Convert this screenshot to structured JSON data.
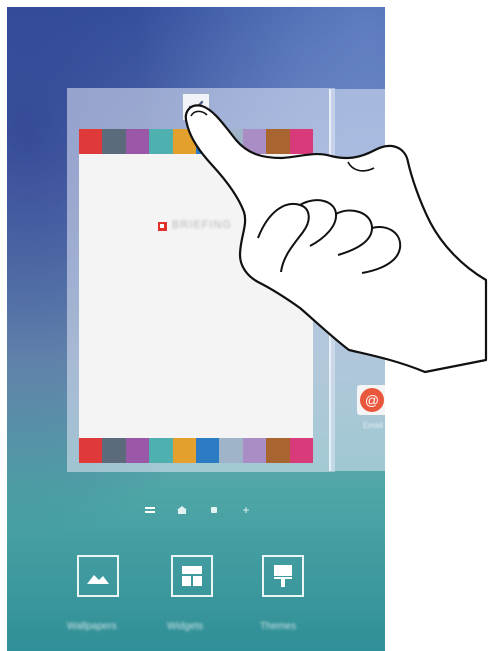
{
  "preview_strip_colors": [
    "#e0393a",
    "#5b6b7c",
    "#9b57a8",
    "#4fb0b0",
    "#e3a02c",
    "#2b7cc2",
    "#9fb4c8",
    "#a98ec6",
    "#a8652f",
    "#d93b7a"
  ],
  "briefing": {
    "label": "BRIEFING"
  },
  "side_panel": {
    "email_label": "Email"
  },
  "bottom_bar": {
    "wallpapers_label": "Wallpapers",
    "widgets_label": "Widgets",
    "themes_label": "Themes"
  },
  "page_indicator": {
    "pages": [
      "lines",
      "home",
      "dot",
      "add"
    ],
    "add_symbol": "+"
  },
  "colors": {
    "accent_check": "#4a5f86",
    "email_icon": "#e9573d"
  }
}
